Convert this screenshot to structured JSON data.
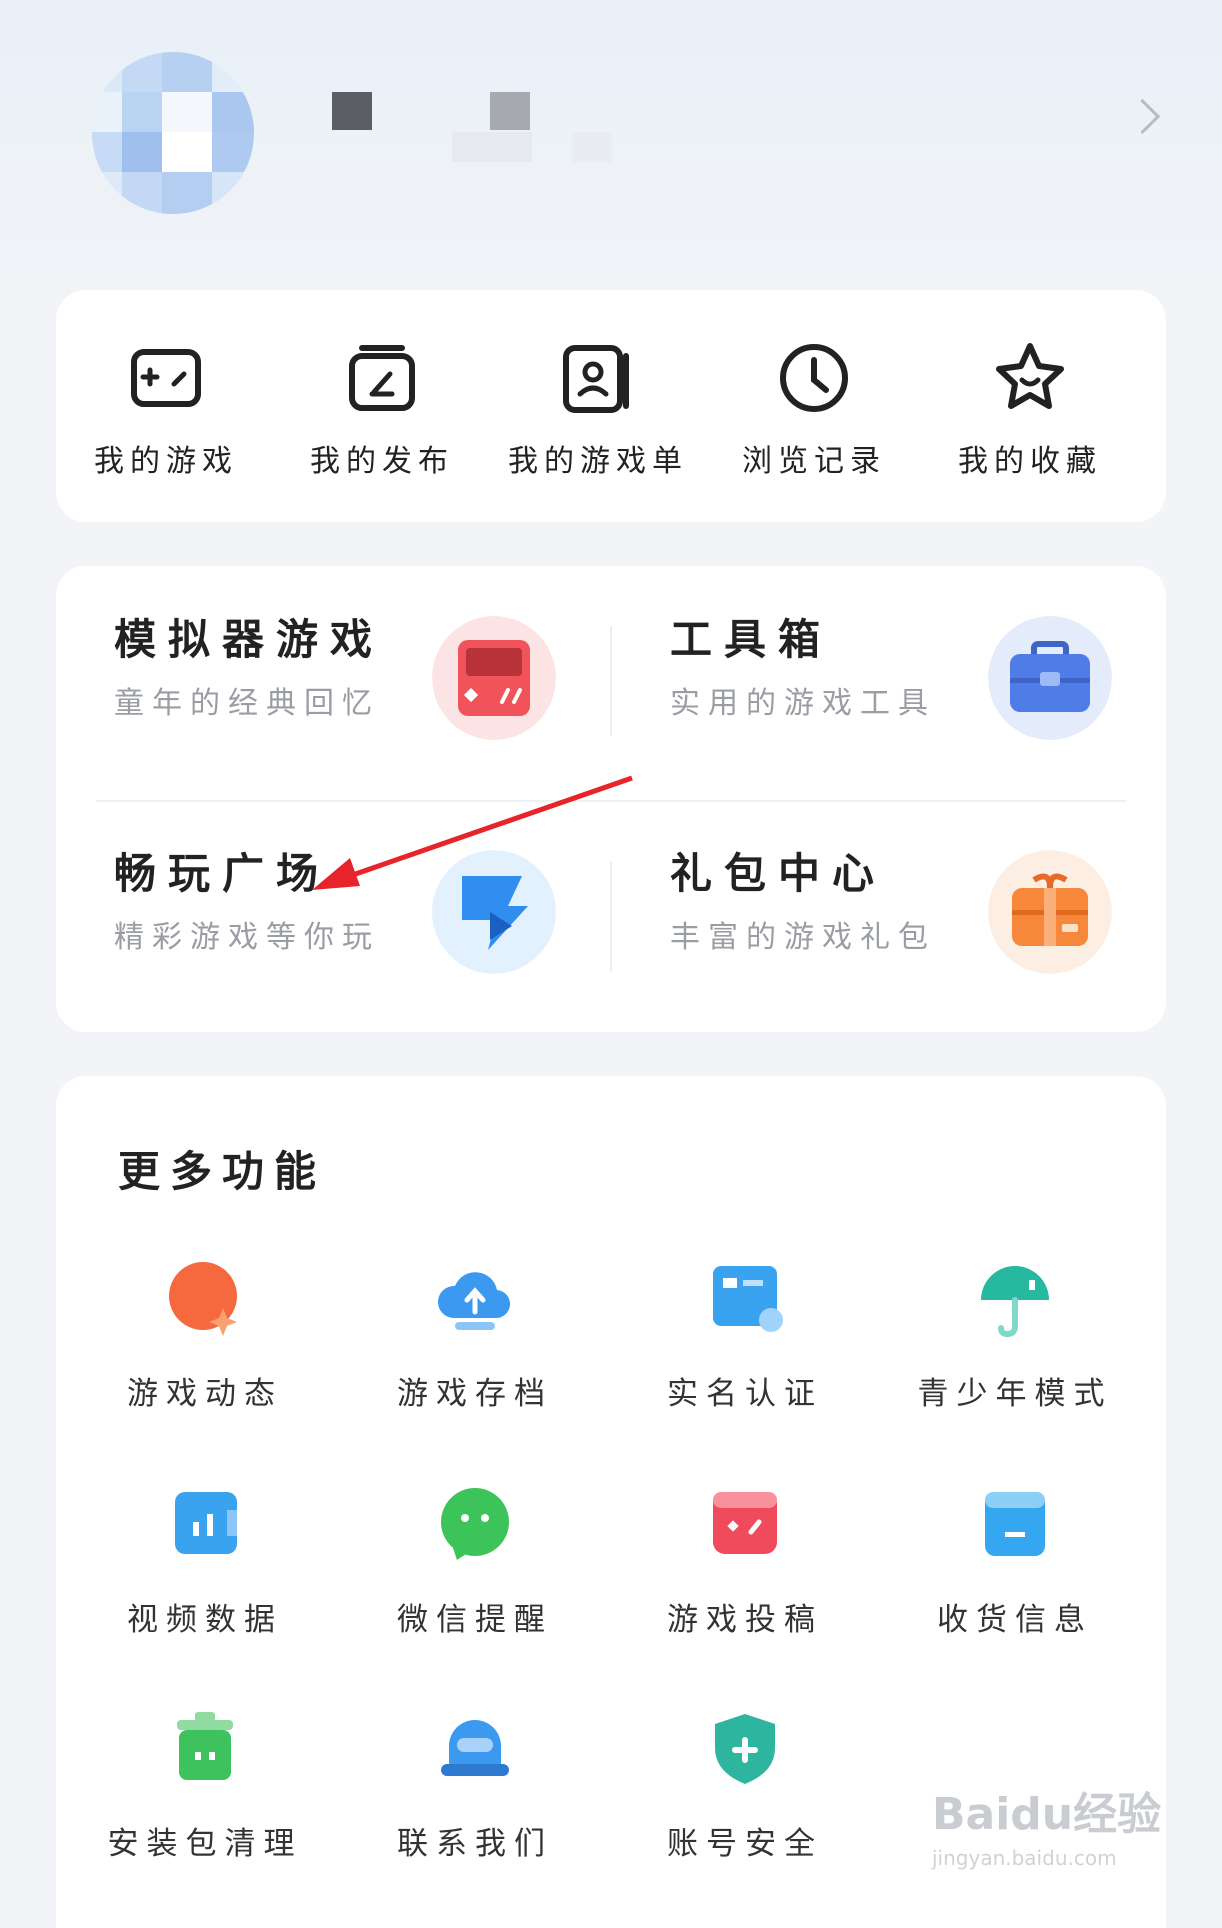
{
  "quick_links": [
    {
      "label": "我的游戏",
      "icon": "gamepad-icon"
    },
    {
      "label": "我的发布",
      "icon": "publish-icon"
    },
    {
      "label": "我的游戏单",
      "icon": "game-list-icon"
    },
    {
      "label": "浏览记录",
      "icon": "clock-icon"
    },
    {
      "label": "我的收藏",
      "icon": "star-icon"
    }
  ],
  "features": [
    {
      "title": "模拟器游戏",
      "subtitle": "童年的经典回忆",
      "icon": "emulator-icon",
      "color": "#f0545a"
    },
    {
      "title": "工具箱",
      "subtitle": "实用的游戏工具",
      "icon": "toolbox-icon",
      "color": "#4f7de8"
    },
    {
      "title": "畅玩广场",
      "subtitle": "精彩游戏等你玩",
      "icon": "play-square-icon",
      "color": "#2f8ef0"
    },
    {
      "title": "礼包中心",
      "subtitle": "丰富的游戏礼包",
      "icon": "gift-icon",
      "color": "#f7873b"
    }
  ],
  "more": {
    "title": "更多功能",
    "items": [
      {
        "label": "游戏动态",
        "icon": "game-news-icon",
        "color": "#f46a3e"
      },
      {
        "label": "游戏存档",
        "icon": "cloud-save-icon",
        "color": "#3b9af0"
      },
      {
        "label": "实名认证",
        "icon": "id-card-icon",
        "color": "#3aa3f0"
      },
      {
        "label": "青少年模式",
        "icon": "umbrella-icon",
        "color": "#27b8a0"
      },
      {
        "label": "视频数据",
        "icon": "video-data-icon",
        "color": "#3aa3f0"
      },
      {
        "label": "微信提醒",
        "icon": "wechat-icon",
        "color": "#3cc45a"
      },
      {
        "label": "游戏投稿",
        "icon": "game-submit-icon",
        "color": "#ef4b5a"
      },
      {
        "label": "收货信息",
        "icon": "shipping-info-icon",
        "color": "#35a7f0"
      },
      {
        "label": "安装包清理",
        "icon": "trash-icon",
        "color": "#3ec25e"
      },
      {
        "label": "联系我们",
        "icon": "customer-service-icon",
        "color": "#3b9af0"
      },
      {
        "label": "账号安全",
        "icon": "shield-icon",
        "color": "#2db5a0"
      }
    ]
  },
  "watermark": {
    "line1": "Baidu经验",
    "line2": "jingyan.baidu.com"
  }
}
